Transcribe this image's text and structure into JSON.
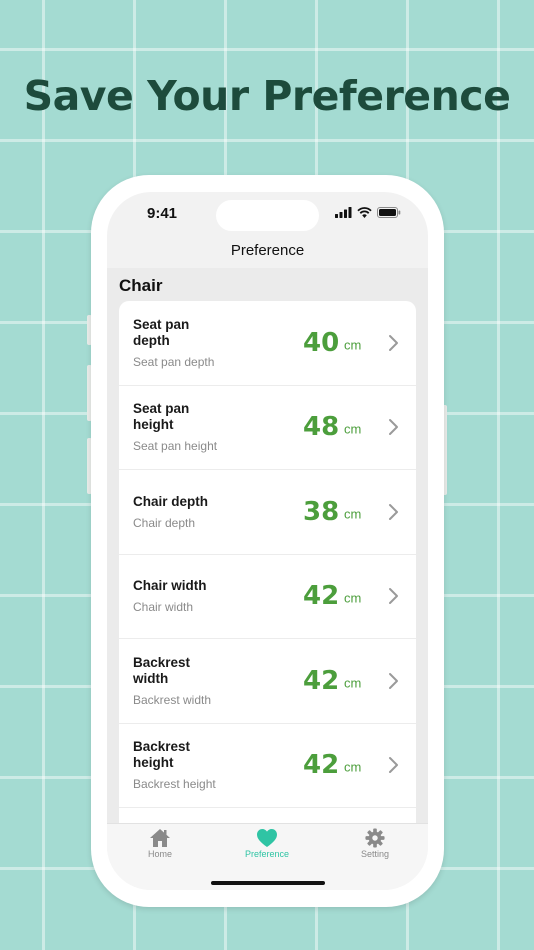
{
  "headline": "Save Your Preference",
  "status_bar": {
    "time": "9:41",
    "icons": [
      "signal-icon",
      "wifi-icon",
      "battery-icon"
    ]
  },
  "nav": {
    "title": "Preference"
  },
  "section": {
    "title": "Chair"
  },
  "items": [
    {
      "name": "Seat pan depth",
      "desc": "Seat pan depth",
      "value": "40",
      "unit": "cm"
    },
    {
      "name": "Seat pan height",
      "desc": "Seat pan height",
      "value": "48",
      "unit": "cm"
    },
    {
      "name": "Chair depth",
      "desc": "Chair depth",
      "value": "38",
      "unit": "cm"
    },
    {
      "name": "Chair width",
      "desc": "Chair width",
      "value": "42",
      "unit": "cm"
    },
    {
      "name": "Backrest width",
      "desc": "Backrest width",
      "value": "42",
      "unit": "cm"
    },
    {
      "name": "Backrest height",
      "desc": "Backrest height",
      "value": "42",
      "unit": "cm"
    }
  ],
  "tabs": [
    {
      "label": "Home",
      "icon": "house-icon",
      "active": false
    },
    {
      "label": "Preference",
      "icon": "heart-icon",
      "active": true
    },
    {
      "label": "Setting",
      "icon": "gear-icon",
      "active": false
    }
  ],
  "colors": {
    "background": "#a4dbd2",
    "headline": "#1d4b3c",
    "value_green": "#4c9e3c",
    "tab_active": "#2fc4a4"
  }
}
